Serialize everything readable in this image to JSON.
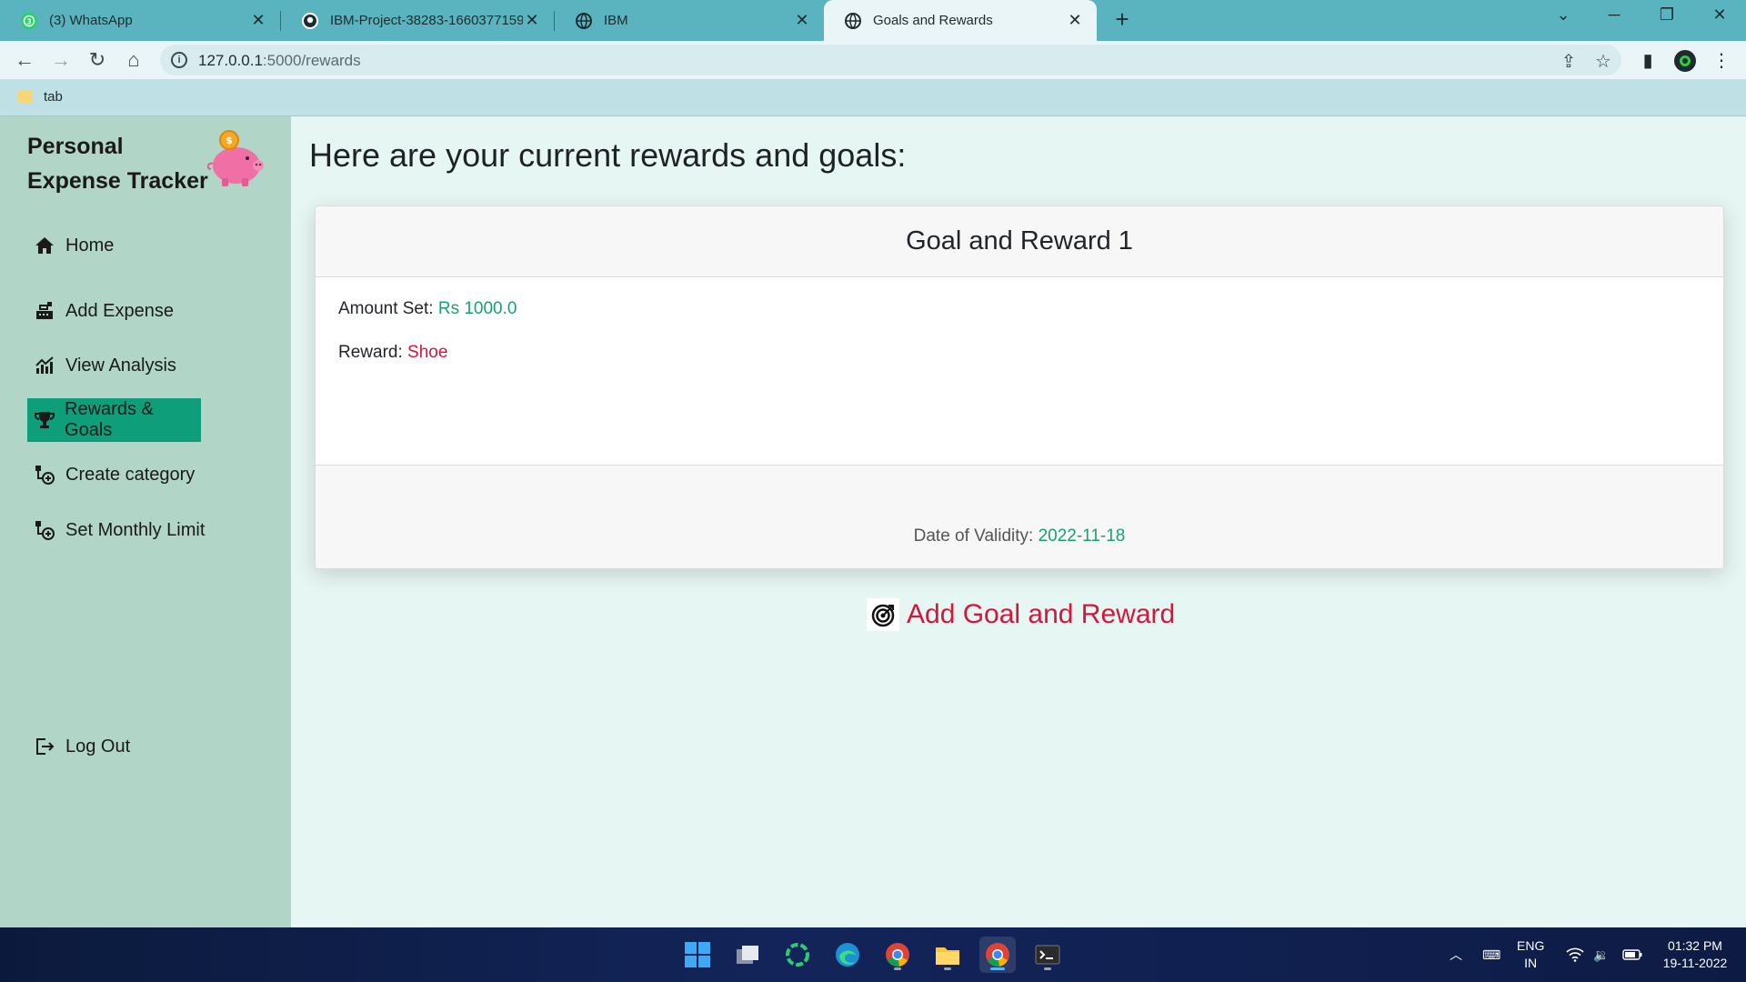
{
  "browser": {
    "tabs": [
      {
        "label": "(3) WhatsApp",
        "icon": "whatsapp-icon"
      },
      {
        "label": "IBM-Project-38283-1660377159/",
        "icon": "github-icon"
      },
      {
        "label": "IBM",
        "icon": "globe-icon"
      },
      {
        "label": "Goals and Rewards",
        "icon": "globe-icon",
        "active": true
      }
    ],
    "url_host": "127.0.0.1",
    "url_path": ":5000/rewards",
    "bookmark_label": "tab"
  },
  "sidebar": {
    "brand_line1": "Personal",
    "brand_line2": "Expense Tracker",
    "items": [
      {
        "label": "Home",
        "icon": "home-icon"
      },
      {
        "label": "Add Expense",
        "icon": "cash-register-icon"
      },
      {
        "label": "View Analysis",
        "icon": "chart-icon"
      },
      {
        "label": "Rewards & Goals",
        "icon": "trophy-icon",
        "active": true
      },
      {
        "label": "Create category",
        "icon": "category-add-icon"
      },
      {
        "label": "Set Monthly Limit",
        "icon": "limit-add-icon"
      }
    ],
    "logout_label": "Log Out"
  },
  "main": {
    "title": "Here are your current rewards and goals:",
    "card": {
      "header": "Goal and Reward 1",
      "amount_label": "Amount Set:",
      "amount_value": "Rs 1000.0",
      "reward_label": "Reward:",
      "reward_value": "Shoe",
      "validity_label": "Date of Validity:",
      "validity_value": "2022-11-18"
    },
    "add_link_label": "Add Goal and Reward"
  },
  "taskbar": {
    "lang_line1": "ENG",
    "lang_line2": "IN",
    "time": "01:32 PM",
    "date": "19-11-2022"
  },
  "colors": {
    "accent_green": "#1a9e78",
    "accent_red": "#d3163c",
    "active_nav": "#0f9e7a",
    "sidebar_bg": "#b1d6c7",
    "tabbar_bg": "#5ab4bf"
  }
}
